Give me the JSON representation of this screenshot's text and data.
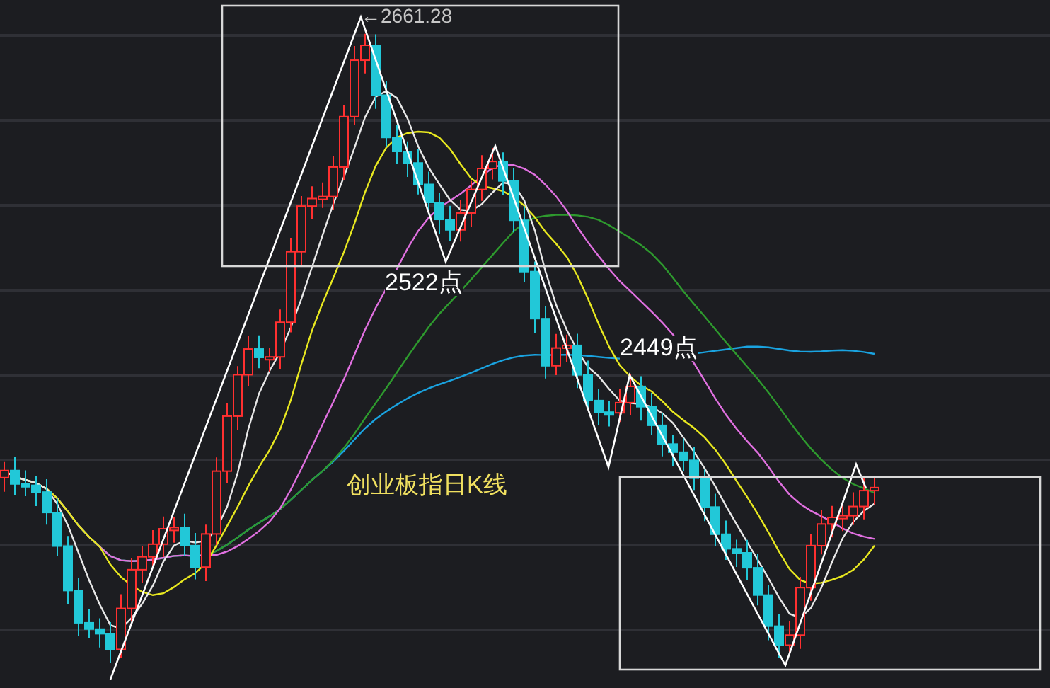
{
  "chart": {
    "title": "创业板指日K线",
    "annotations": [
      {
        "kind": "peak",
        "text": "←2661.28"
      },
      {
        "kind": "low",
        "text": "2522点"
      },
      {
        "kind": "low",
        "text": "2449点"
      }
    ]
  }
}
